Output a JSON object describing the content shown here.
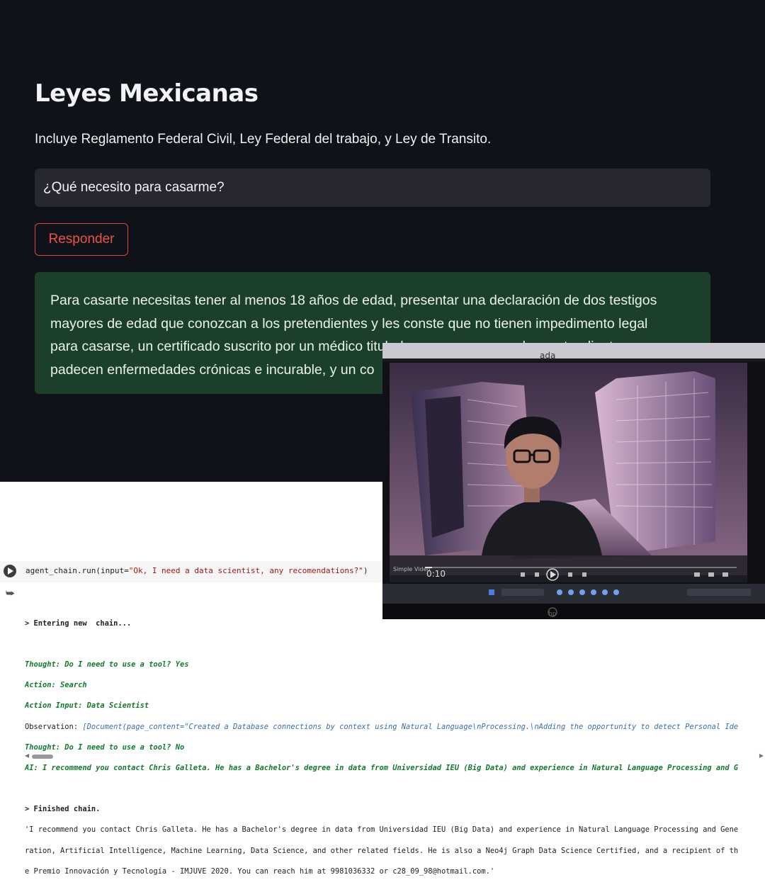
{
  "app": {
    "title": "Leyes Mexicanas",
    "subtitle": "Incluye Reglamento Federal Civil, Ley Federal del trabajo, y Ley de Transito.",
    "query": "¿Qué necesito para casarme?",
    "button_label": "Responder",
    "answer_lines": [
      "Para casarte necesitas tener al menos 18 años de edad, presentar una declaración de dos testigos",
      "mayores de edad que conozcan a los pretendientes y les conste que no tienen impedimento legal",
      "para casarse, un certificado suscrito por un médico titulado que asegure que los pretendientes no",
      "padecen enfermedades crónicas e incurable, y un co"
    ]
  },
  "notebook": {
    "code_prefix": "agent_chain.run(input=",
    "code_string": "\"Ok, I need a data scientist, any recomendations?\"",
    "code_suffix": ")",
    "entering": "> Entering new  chain...",
    "thought1": "Thought: Do I need to use a tool? Yes",
    "action": "Action: Search",
    "action_input": "Action Input: Data Scientist",
    "observation_label": "Observation: ",
    "observation_value": "[Document(page_content=\"Created a Database connections by context using Natural Language\\nProcessing.\\nAdding the opportunity to detect Personal Ide",
    "thought2": "Thought: Do I need to use a tool? No",
    "ai_line": "AI: I recommend you contact Chris Galleta. He has a Bachelor's degree in data from Universidad IEU (Big Data) and experience in Natural Language Processing and G",
    "finished": "> Finished chain.",
    "result_lines": [
      "'I recommend you contact Chris Galleta. He has a Bachelor's degree in data from Universidad IEU (Big Data) and experience in Natural Language Processing and Gene",
      "ration, Artificial Intelligence, Machine Learning, Data Science, and other related fields. He is also a Neo4j Graph Data Science Certified, and a recipient of th",
      "e Premio Innovación y Tecnología - IMJUVE 2020. You can reach him at 9981036332 or c28_09_98@hotmail.com.'"
    ]
  },
  "video": {
    "top_label": "ada",
    "time": "0:10",
    "player_label": "Simple Video",
    "brand": "hp"
  },
  "icons": {
    "run": "play-circle-icon",
    "output": "output-arrow-icon"
  },
  "colors": {
    "app_bg": "#10121a",
    "input_bg": "#262730",
    "button_accent": "#e2443f",
    "answer_bg": "#1c3f2b",
    "thought_green": "#117a2d",
    "observation_blue": "#3a6fa8"
  }
}
